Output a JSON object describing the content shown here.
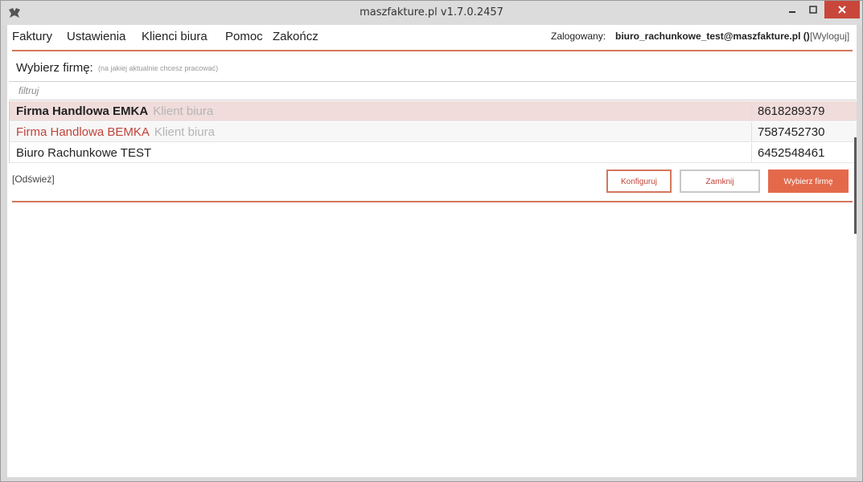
{
  "window": {
    "title": "maszfakture.pl  v1.7.0.2457"
  },
  "menu": {
    "items": [
      {
        "label": "Faktury"
      },
      {
        "label": "Ustawienia"
      },
      {
        "label": "Klienci biura"
      },
      {
        "label": "Pomoc"
      },
      {
        "label": "Zakończ"
      }
    ]
  },
  "login": {
    "label": "Zalogowany:",
    "user": "biuro_rachunkowe_test@maszfakture.pl ()",
    "logout": "[Wyloguj]"
  },
  "chooser": {
    "label": "Wybierz firmę:",
    "hint": "(na jakiej aktualnie chcesz pracować)",
    "filter_placeholder": "filtruj"
  },
  "companies": [
    {
      "name": "Firma Handlowa EMKA",
      "tag": "Klient biura",
      "nip": "8618289379"
    },
    {
      "name": "Firma Handlowa BEMKA",
      "tag": "Klient biura",
      "nip": "7587452730"
    },
    {
      "name": "Biuro Rachunkowe TEST",
      "tag": "",
      "nip": "6452548461"
    }
  ],
  "actions": {
    "refresh": "[Odśwież]",
    "configure": "Konfiguruj",
    "close": "Zamknij",
    "choose": "Wybierz firmę"
  },
  "colors": {
    "accent": "#e4694b",
    "accent_dark": "#c0443a",
    "selected_row": "#f0dcda",
    "close_button": "#c9473a"
  }
}
